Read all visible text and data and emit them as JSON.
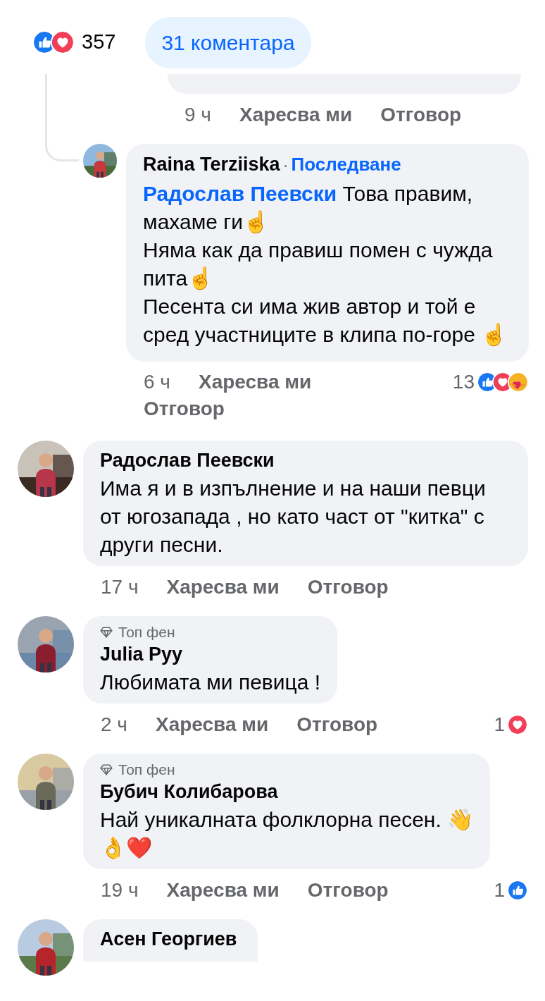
{
  "summary": {
    "reactions": [
      {
        "kind": "like"
      },
      {
        "kind": "love"
      }
    ],
    "count": "357",
    "comments_button": "31 коментара"
  },
  "replies": [
    {
      "kind": "cut",
      "time": "9 ч",
      "like": "Харесва ми",
      "reply": "Отговор"
    },
    {
      "kind": "full",
      "author": "Raina Terziiska",
      "separator": "·",
      "follow": "Последване",
      "mention": "Радослав Пеевски",
      "text": "Това правим, махаме ги☝\nНяма как да правиш помен с чужда пита☝\nПесента си има жив автор и той е сред участниците в клипа по-горе ☝",
      "time": "6 ч",
      "like": "Харесва ми",
      "reply": "Отговор",
      "reaction_count": "13",
      "reactions": [
        {
          "kind": "like"
        },
        {
          "kind": "love"
        },
        {
          "kind": "care"
        }
      ]
    }
  ],
  "comments": [
    {
      "author": "Радослав Пеевски",
      "text": "Има я и в изпълнение и на наши певци от югозапада , но като част от \"китка\" с други песни.",
      "time": "17 ч",
      "like": "Харесва ми",
      "reply": "Отговор"
    },
    {
      "badge": "Топ фен",
      "author": "Julia Pyy",
      "text": "Любимата ми певица !",
      "time": "2 ч",
      "like": "Харесва ми",
      "reply": "Отговор",
      "reaction_count": "1",
      "reactions": [
        {
          "kind": "love"
        }
      ]
    },
    {
      "badge": "Топ фен",
      "author": "Бубич Колибарова",
      "text": "Най уникалната фолклорна песен. 👋\n👌❤️",
      "time": "19 ч",
      "like": "Харесва ми",
      "reply": "Отговор",
      "reaction_count": "1",
      "reactions": [
        {
          "kind": "like"
        }
      ]
    },
    {
      "author": "Асен Георгиев"
    }
  ]
}
